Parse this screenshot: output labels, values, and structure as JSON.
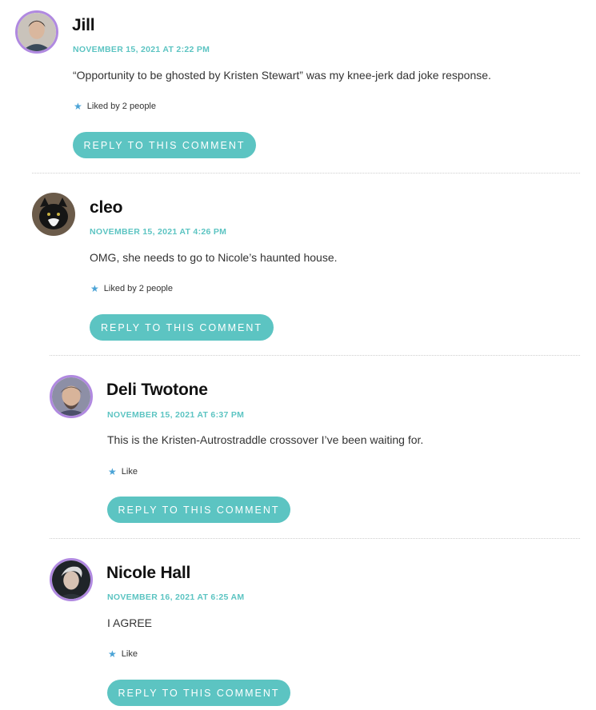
{
  "comments": [
    {
      "author": "Jill",
      "date": "NOVEMBER 15, 2021 AT 2:22 PM",
      "text": "“Opportunity to be ghosted by Kristen Stewart” was my knee-jerk dad joke response.",
      "likes": "Liked by 2 people",
      "reply": "REPLY TO THIS COMMENT"
    },
    {
      "author": "cleo",
      "date": "NOVEMBER 15, 2021 AT 4:26 PM",
      "text": "OMG, she needs to go to Nicole’s haunted house.",
      "likes": "Liked by 2 people",
      "reply": "REPLY TO THIS COMMENT"
    },
    {
      "author": "Deli Twotone",
      "date": "NOVEMBER 15, 2021 AT 6:37 PM",
      "text": "This is the Kristen-Autrostraddle crossover I’ve been waiting for.",
      "likes": "Like",
      "reply": "REPLY TO THIS COMMENT"
    },
    {
      "author": "Nicole Hall",
      "date": "NOVEMBER 16, 2021 AT 6:25 AM",
      "text": "I AGREE",
      "likes": "Like",
      "reply": "REPLY TO THIS COMMENT"
    }
  ],
  "colors": {
    "accent": "#5cc4c2",
    "avatar_ring": "#b089e0",
    "star": "#4aa3d6"
  },
  "icons": {
    "like": "star-icon"
  }
}
